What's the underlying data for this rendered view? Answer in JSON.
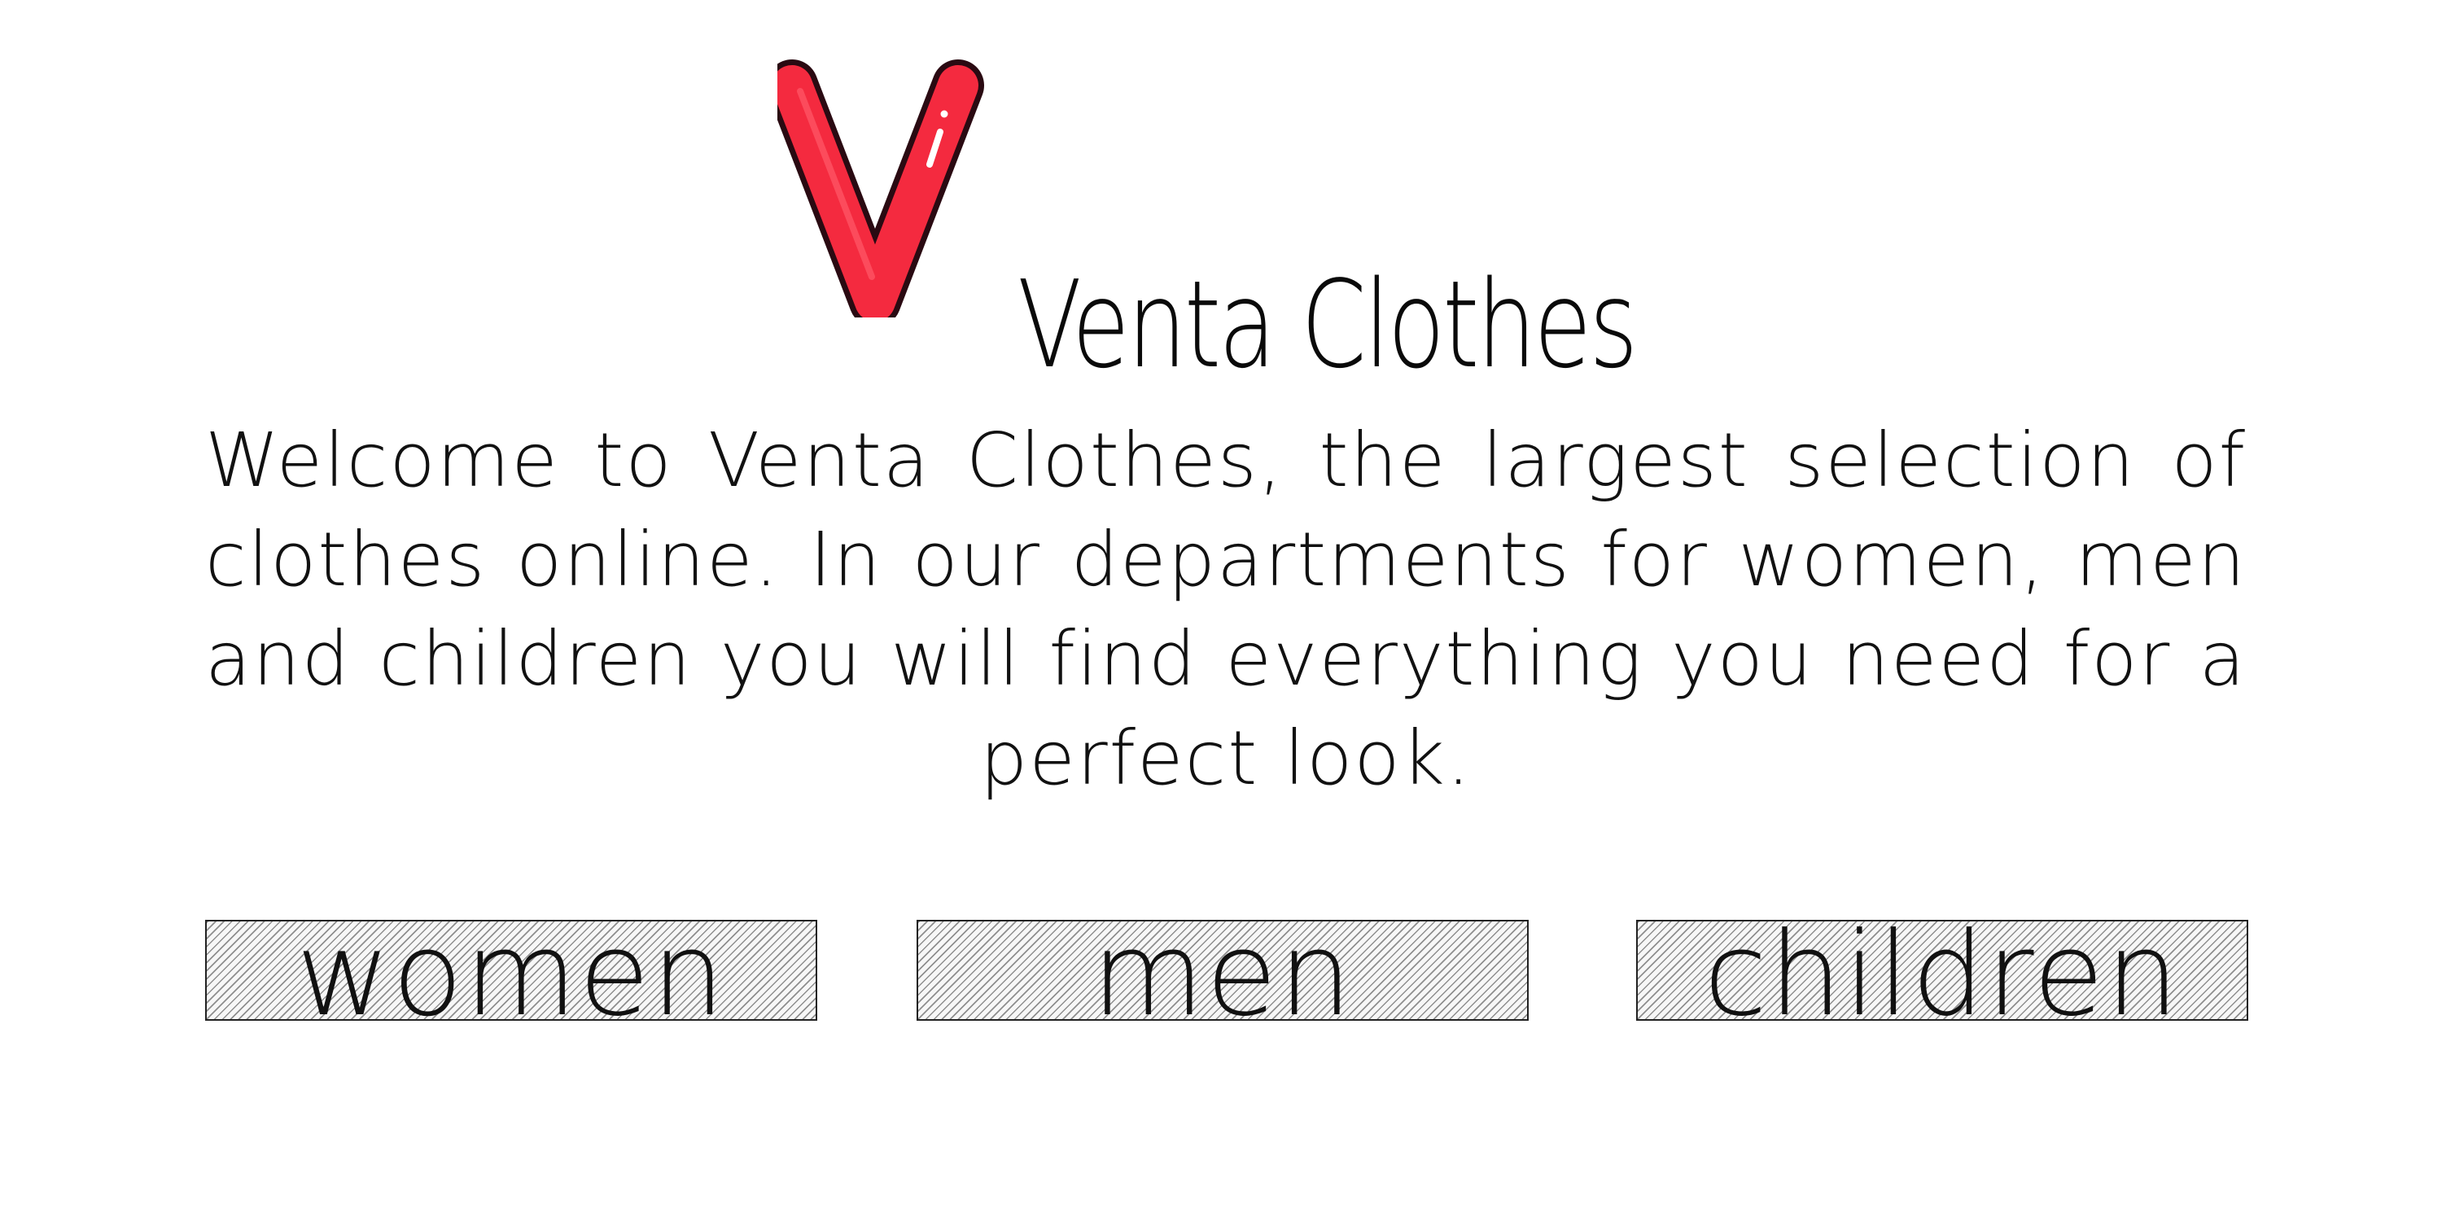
{
  "brand": {
    "name": "Venta Clothes",
    "logo_icon": "venta-v-logo-icon",
    "logo_color": "#f42a3f"
  },
  "intro": {
    "text": "Welcome to Venta Clothes, the largest selection of clothes online. In our departments for women,  men and children you will find everything you need for a perfect look."
  },
  "departments": [
    {
      "label": "women"
    },
    {
      "label": "men"
    },
    {
      "label": "children"
    }
  ]
}
